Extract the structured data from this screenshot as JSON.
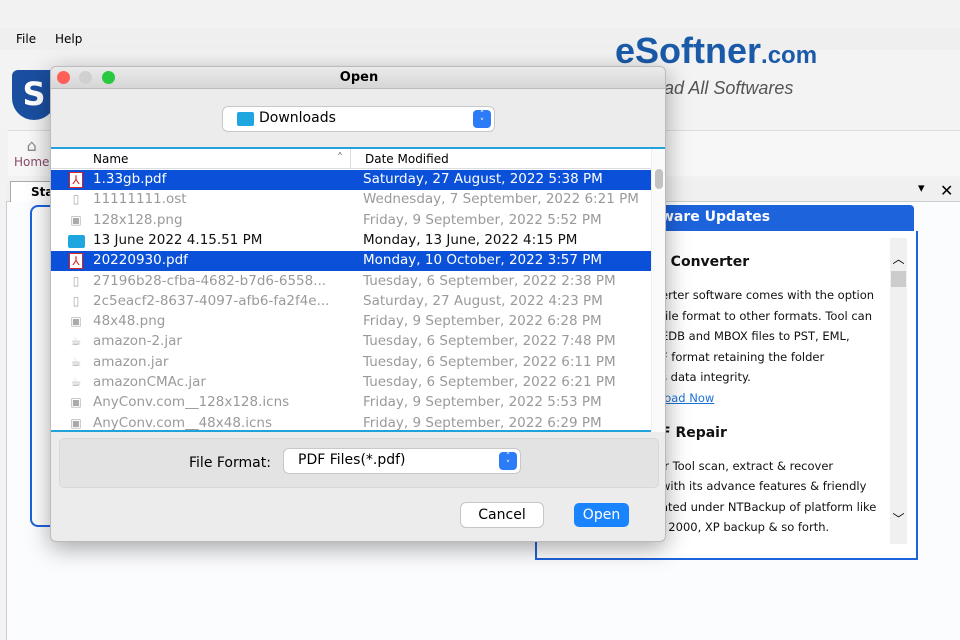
{
  "menu": {
    "file": "File",
    "help": "Help"
  },
  "brand": {
    "name": "eSoftner",
    "tld": ".com",
    "tagline": "nload All Softwares",
    "logo_letter": "S"
  },
  "toolbar": {
    "home": "Home"
  },
  "tab": {
    "start": "Sta"
  },
  "updates": {
    "title": "ware Updates",
    "h1": "l Converter",
    "p1": [
      "erter software comes with the option",
      "file format to other formats. Tool can",
      "EDB and MBOX files to PST, EML,",
      "F format retaining the folder",
      "s data integrity."
    ],
    "link": "load Now",
    "h2": "F Repair",
    "p2": [
      "ir Tool scan, extract & recover",
      "with its advance features & friendly",
      "ated under NTBackup of platform like",
      ", 2000, XP backup & so forth."
    ]
  },
  "dialog": {
    "title": "Open",
    "folder": "Downloads",
    "columns": {
      "name": "Name",
      "date": "Date Modified"
    },
    "files": [
      {
        "name": "1.33gb.pdf",
        "date": "Saturday, 27 August, 2022 5:38 PM",
        "icon": "pdf-icon",
        "state": "selected"
      },
      {
        "name": "11111111.ost",
        "date": "Wednesday, 7 September, 2022 6:21 PM",
        "icon": "file-icon",
        "state": "disabled"
      },
      {
        "name": "128x128.png",
        "date": "Friday, 9 September, 2022 5:52 PM",
        "icon": "image-icon",
        "state": "disabled"
      },
      {
        "name": "13 June 2022 4.15.51 PM",
        "date": "Monday, 13 June, 2022 4:15 PM",
        "icon": "folder-icon",
        "state": "folder"
      },
      {
        "name": "20220930.pdf",
        "date": "Monday, 10 October, 2022 3:57 PM",
        "icon": "pdf-icon",
        "state": "selected"
      },
      {
        "name": "27196b28-cfba-4682-b7d6-6558...",
        "date": "Tuesday, 6 September, 2022 2:38 PM",
        "icon": "file-icon",
        "state": "disabled"
      },
      {
        "name": "2c5eacf2-8637-4097-afb6-fa2f4e...",
        "date": "Saturday, 27 August, 2022 4:23 PM",
        "icon": "file-icon",
        "state": "disabled"
      },
      {
        "name": "48x48.png",
        "date": "Friday, 9 September, 2022 6:28 PM",
        "icon": "image-icon",
        "state": "disabled"
      },
      {
        "name": "amazon-2.jar",
        "date": "Tuesday, 6 September, 2022 7:48 PM",
        "icon": "jar-icon",
        "state": "disabled"
      },
      {
        "name": "amazon.jar",
        "date": "Tuesday, 6 September, 2022 6:11 PM",
        "icon": "jar-icon",
        "state": "disabled"
      },
      {
        "name": "amazonCMAc.jar",
        "date": "Tuesday, 6 September, 2022 6:21 PM",
        "icon": "jar-icon",
        "state": "disabled"
      },
      {
        "name": "AnyConv.com__128x128.icns",
        "date": "Friday, 9 September, 2022 5:53 PM",
        "icon": "image-icon",
        "state": "disabled"
      },
      {
        "name": "AnyConv.com__48x48.icns",
        "date": "Friday, 9 September, 2022 6:29 PM",
        "icon": "image-icon",
        "state": "disabled"
      }
    ],
    "format_label": "File Format:",
    "format_value": "PDF Files(*.pdf)",
    "cancel": "Cancel",
    "open": "Open"
  }
}
